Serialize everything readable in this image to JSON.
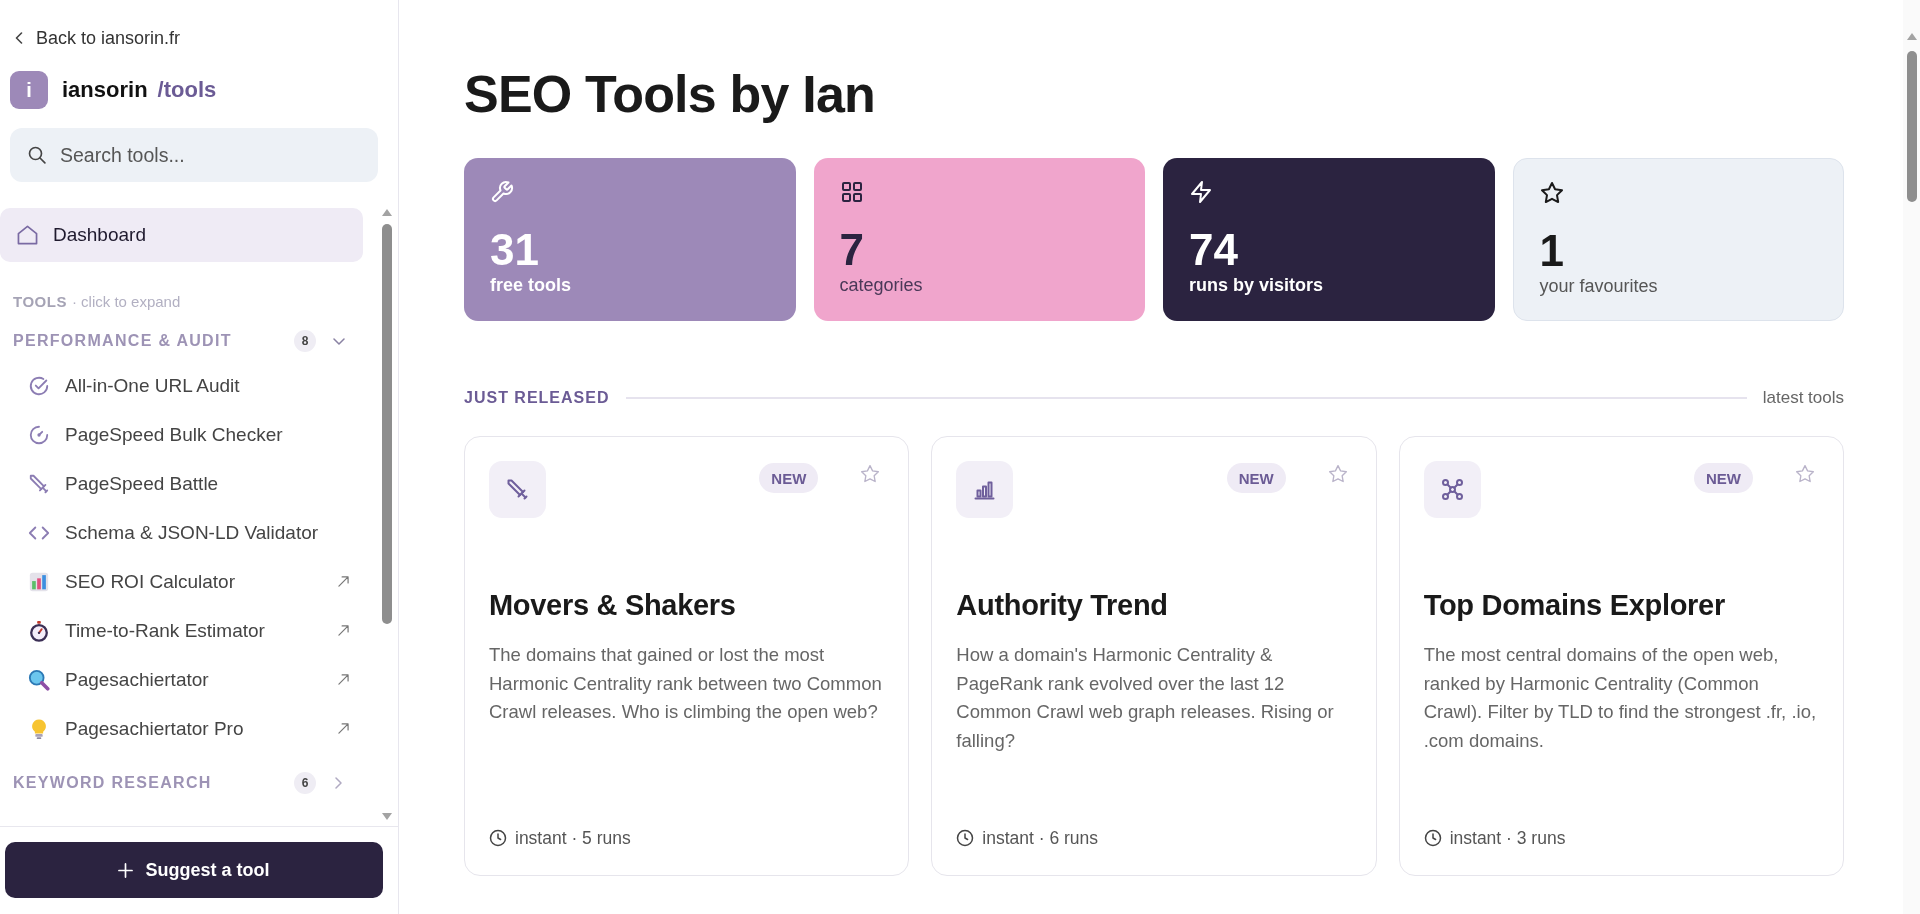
{
  "sidebar": {
    "back_link": "Back to iansorin.fr",
    "brand": {
      "logo": "i",
      "name": "iansorin",
      "path": "/tools"
    },
    "search": {
      "placeholder": "Search tools..."
    },
    "nav": [
      {
        "label": "Dashboard",
        "selected": true
      }
    ],
    "tools_heading": {
      "label": "TOOLS",
      "hint": "· click to expand"
    },
    "categories": [
      {
        "name": "PERFORMANCE & AUDIT",
        "count": "8",
        "expanded": true,
        "items": [
          {
            "label": "All-in-One URL Audit",
            "external": false
          },
          {
            "label": "PageSpeed Bulk Checker",
            "external": false
          },
          {
            "label": "PageSpeed Battle",
            "external": false
          },
          {
            "label": "Schema & JSON-LD Validator",
            "external": false
          },
          {
            "label": "SEO ROI Calculator",
            "external": true
          },
          {
            "label": "Time-to-Rank Estimator",
            "external": true
          },
          {
            "label": "Pagesachiertator",
            "external": true
          },
          {
            "label": "Pagesachiertator Pro",
            "external": true
          }
        ]
      },
      {
        "name": "KEYWORD RESEARCH",
        "count": "6",
        "expanded": false
      }
    ],
    "suggest_button": "Suggest a tool"
  },
  "main": {
    "title": "SEO Tools by Ian",
    "stats": [
      {
        "value": "31",
        "label": "free tools"
      },
      {
        "value": "7",
        "label": "categories"
      },
      {
        "value": "74",
        "label": "runs by visitors"
      },
      {
        "value": "1",
        "label": "your favourites"
      }
    ],
    "section": {
      "title": "JUST RELEASED",
      "aside": "latest tools"
    },
    "tools": [
      {
        "title": "Movers & Shakers",
        "badge": "NEW",
        "favourite": false,
        "description": "The domains that gained or lost the most Harmonic Centrality rank between two Common Crawl releases. Who is climbing the open web?",
        "meta": "instant · 5 runs"
      },
      {
        "title": "Authority Trend",
        "badge": "NEW",
        "favourite": false,
        "description": "How a domain's Harmonic Centrality & PageRank rank evolved over the last 12 Common Crawl web graph releases. Rising or falling?",
        "meta": "instant · 6 runs"
      },
      {
        "title": "Top Domains Explorer",
        "badge": "NEW",
        "favourite": false,
        "description": "The most central domains of the open web, ranked by Harmonic Centrality (Common Crawl). Filter by TLD to find the strongest .fr, .io, .com domains.",
        "meta": "instant · 3 runs"
      }
    ]
  }
}
